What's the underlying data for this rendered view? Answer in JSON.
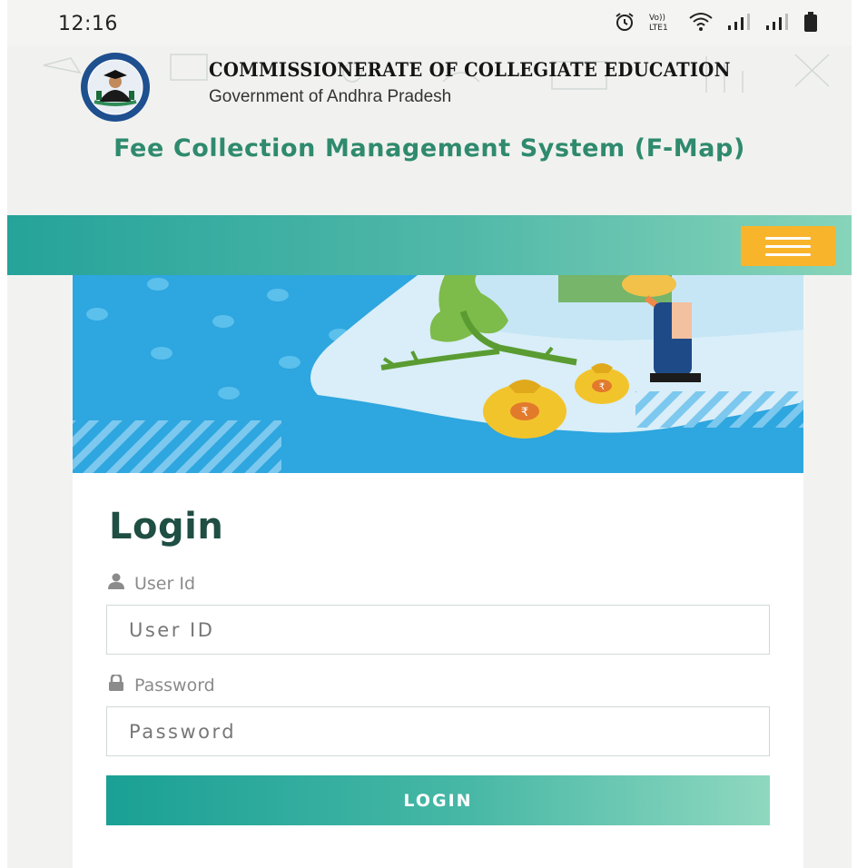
{
  "status_bar": {
    "time": "12:16",
    "icons": [
      "alarm-icon",
      "volte-icon",
      "wifi-icon",
      "signal-icon",
      "signal-icon",
      "battery-icon"
    ]
  },
  "header": {
    "org_name": "COMMISSIONERATE OF COLLEGIATE EDUCATION",
    "org_sub": "Government of Andhra Pradesh",
    "system_title": "Fee Collection Management System (F-Map)",
    "seal_text_top": "Commissionerate of Collegiate Education",
    "seal_text_bottom": "Government of Andhra Pradesh"
  },
  "navbar": {
    "menu_icon": "hamburger-menu-icon",
    "accent_color": "#f8b42b"
  },
  "banner": {
    "illustration": "money-bags-illustration",
    "currency_symbol": "₹"
  },
  "login": {
    "heading": "Login",
    "user_label": "User Id",
    "user_icon": "user-icon",
    "user_placeholder": "User ID",
    "password_label": "Password",
    "password_icon": "lock-icon",
    "password_placeholder": "Password",
    "button_label": "LOGIN"
  },
  "colors": {
    "brand_teal": "#2f8a6e",
    "heading_dark": "#1f4e43",
    "banner_blue": "#2ea6df"
  }
}
